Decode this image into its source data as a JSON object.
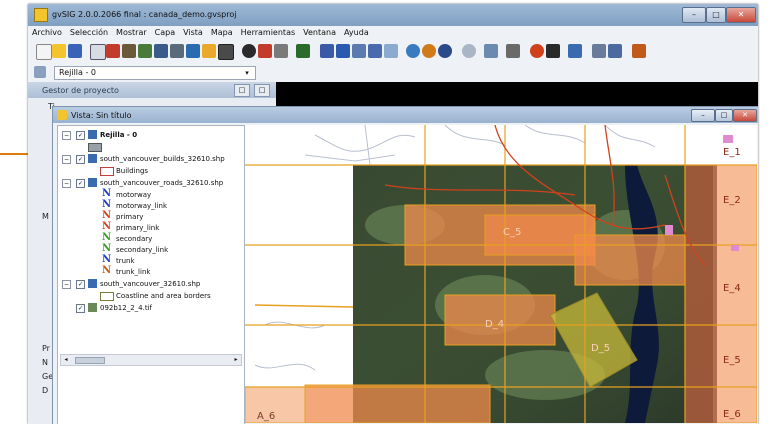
{
  "window": {
    "title": "gvSIG 2.0.0.2066 final : canada_demo.gvsproj",
    "buttons": {
      "minimize": "–",
      "maximize": "□",
      "close": "✕"
    }
  },
  "menubar": [
    "Archivo",
    "Selección",
    "Mostrar",
    "Capa",
    "Vista",
    "Mapa",
    "Herramientas",
    "Ventana",
    "Ayuda"
  ],
  "toolbar2": {
    "combo_value": "Rejilla - 0",
    "combo_arrow": "▾"
  },
  "gestor": {
    "title": "Gestor de proyecto",
    "letters": [
      "Ti",
      "M",
      "Pr",
      "N",
      "Ge",
      "D"
    ]
  },
  "vista": {
    "title": "Vista: Sin título",
    "buttons": {
      "minimize": "–",
      "maximize": "□",
      "close": "✕"
    }
  },
  "toc": {
    "items": [
      {
        "label": "Rejilla - 0",
        "bold": true
      },
      {
        "label": "south_vancouver_builds_32610.shp"
      },
      {
        "label": "Buildings",
        "legend": "box"
      },
      {
        "label": "south_vancouver_roads_32610.shp"
      },
      {
        "label": "motorway",
        "legend": "line",
        "color": "#1f3fbf"
      },
      {
        "label": "motorway_link",
        "legend": "line",
        "color": "#1f3fbf"
      },
      {
        "label": "primary",
        "legend": "line",
        "color": "#d0421b"
      },
      {
        "label": "primary_link",
        "legend": "line",
        "color": "#d0421b"
      },
      {
        "label": "secondary",
        "legend": "line",
        "color": "#3a9a2a"
      },
      {
        "label": "secondary_link",
        "legend": "line",
        "color": "#3a9a2a"
      },
      {
        "label": "trunk",
        "legend": "line",
        "color": "#1f3fbf"
      },
      {
        "label": "trunk_link",
        "legend": "line",
        "color": "#c05a1a"
      },
      {
        "label": "south_vancouver_32610.shp"
      },
      {
        "label": "Coastline and area borders",
        "legend": "box"
      },
      {
        "label": "092b12_2_4.tif"
      }
    ],
    "scroll_left": "◂",
    "scroll_right": "▸"
  },
  "map": {
    "grid_labels": [
      "E_1",
      "E_2",
      "E_4",
      "E_5",
      "E_6",
      "A_6",
      "C_5",
      "D_4",
      "D_5"
    ],
    "colors": {
      "grid_fill": "#f08a4b",
      "grid_line": "#e8a020",
      "satellite": "#2c3a2a",
      "water": "#0d1a3a",
      "highlight": "#c8b93a"
    }
  }
}
